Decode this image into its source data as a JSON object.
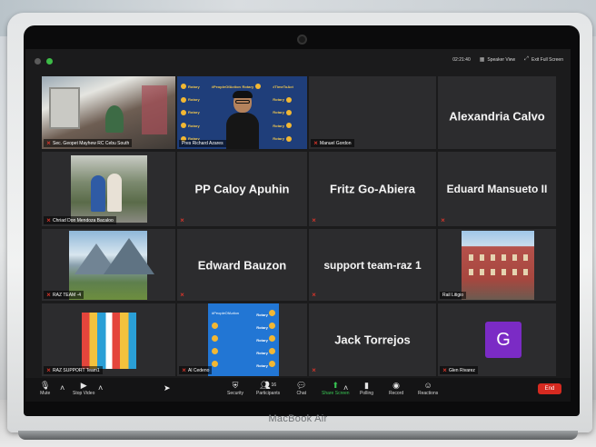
{
  "topbar": {
    "time": "02:21:40",
    "speaker_view": "Speaker View",
    "exit_full_screen": "Exit Full Screen"
  },
  "tiles": [
    {
      "label": "Sec. Geopet Mayhew RC Cebu South"
    },
    {
      "label": "Pres Richard Azares"
    },
    {
      "label": "Manuel Gordon"
    },
    {
      "name": "Alexandria Calvo"
    },
    {
      "label": "Chriad Don Mendoza Bacaloo"
    },
    {
      "name": "PP Caloy Apuhin"
    },
    {
      "name": "Fritz Go-Abiera"
    },
    {
      "name": "Eduard Mansueto II"
    },
    {
      "label": "RAZ TEAM -4"
    },
    {
      "name": "Edward Bauzon"
    },
    {
      "name": "support team-raz 1"
    },
    {
      "label": "Rail Litigio"
    },
    {
      "label": "RAZ SUPPORT Team1"
    },
    {
      "label": "Al Cedeno"
    },
    {
      "name": "Jack Torrejos"
    },
    {
      "label": "Glen Rivarez",
      "avatar_letter": "G"
    }
  ],
  "rotary_text": "Rotary",
  "toolbar": {
    "mute": "Mute",
    "stop_video": "Stop Video",
    "security": "Security",
    "participants": "Participants",
    "participants_count": "16",
    "chat": "Chat",
    "share_screen": "Share Screen",
    "polling": "Polling",
    "record": "Record",
    "reactions": "Reactions",
    "end": "End"
  },
  "laptop_brand": "MacBook Air",
  "colors": {
    "active_speaker": "#9bd53c",
    "share_green": "#38c553",
    "end_red": "#d62a20",
    "avatar_purple": "#7b2bc5",
    "muted_red": "#e0362b"
  }
}
